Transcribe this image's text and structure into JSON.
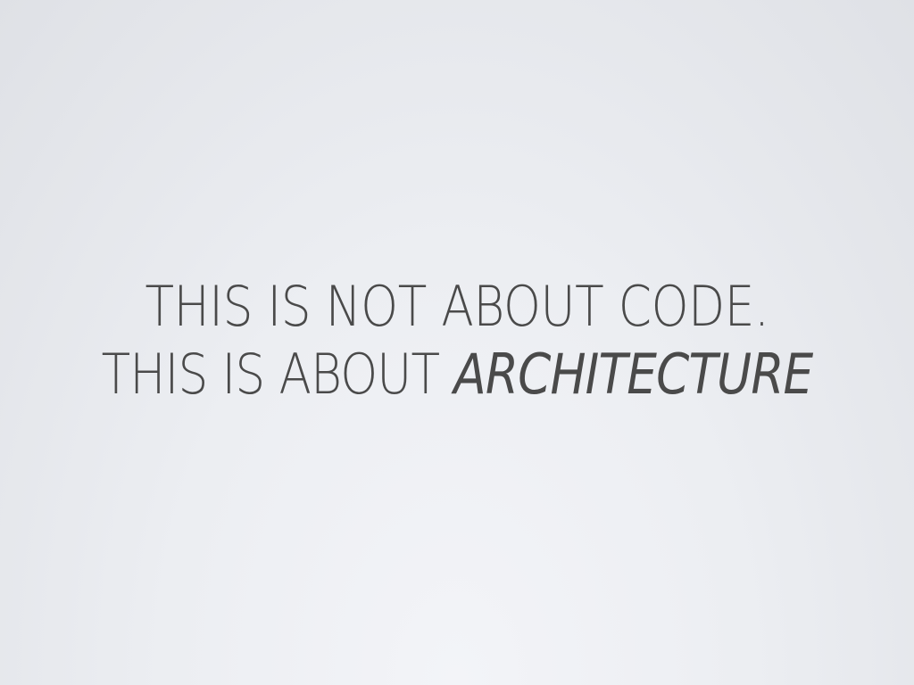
{
  "slide": {
    "line1": "THIS IS NOT ABOUT CODE.",
    "line2_prefix": "THIS IS ABOUT ",
    "line2_emphasis": "ARCHITECTURE"
  },
  "colors": {
    "text": "#4a4a4a",
    "background_light": "#f3f4f8",
    "background_edge": "#dfe1e6"
  }
}
